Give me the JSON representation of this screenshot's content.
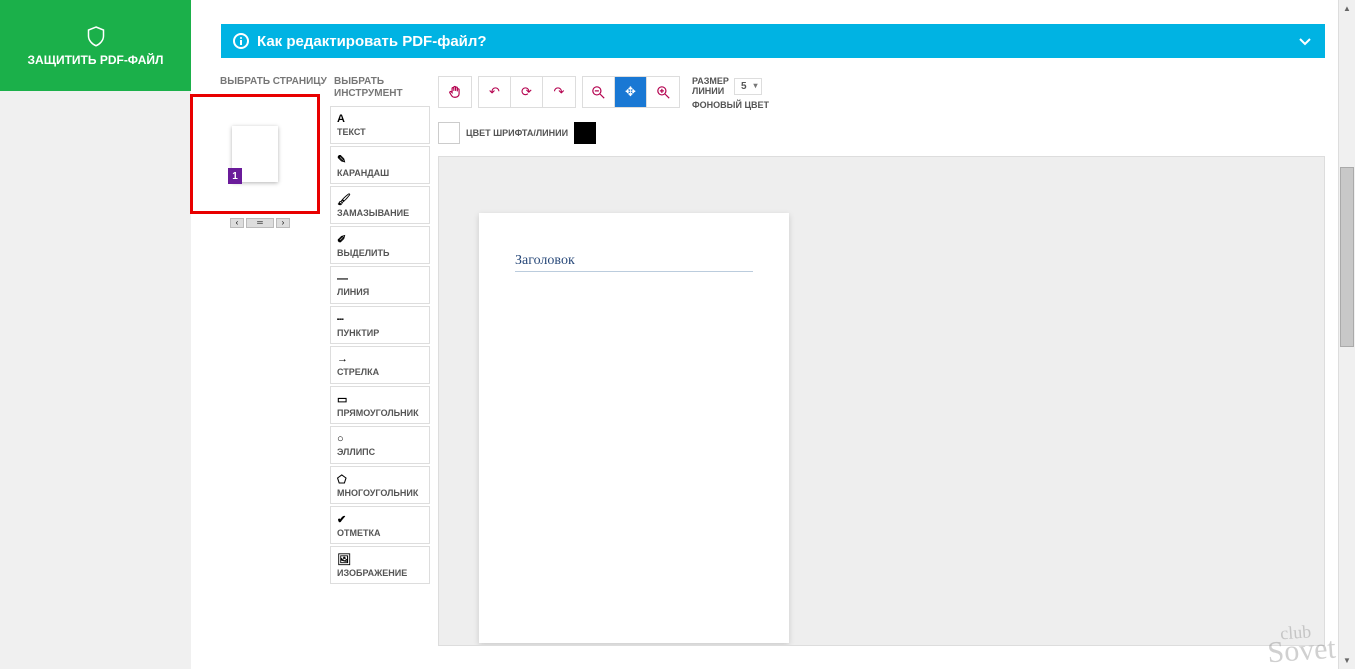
{
  "protect": {
    "label": "ЗАЩИТИТЬ PDF-ФАЙЛ"
  },
  "help_bar": {
    "text": "Как редактировать PDF-файл?"
  },
  "page_selector": {
    "header": "ВЫБРАТЬ СТРАНИЦУ",
    "current": "1"
  },
  "tool_selector": {
    "header": "ВЫБРАТЬ ИНСТРУМЕНТ",
    "tools": [
      {
        "label": "ТЕКСТ"
      },
      {
        "label": "КАРАНДАШ"
      },
      {
        "label": "ЗАМАЗЫВАНИЕ"
      },
      {
        "label": "ВЫДЕЛИТЬ"
      },
      {
        "label": "ЛИНИЯ"
      },
      {
        "label": "ПУНКТИР"
      },
      {
        "label": "СТРЕЛКА"
      },
      {
        "label": "ПРЯМОУГОЛЬНИК"
      },
      {
        "label": "ЭЛЛИПС"
      },
      {
        "label": "МНОГОУГОЛЬНИК"
      },
      {
        "label": "ОТМЕТКА"
      },
      {
        "label": "ИЗОБРАЖЕНИЕ"
      }
    ]
  },
  "toolbar": {
    "size_label": "РАЗМЕР ЛИНИИ",
    "size_value": "5",
    "bg_label": "ФОНОВЫЙ ЦВЕТ",
    "font_color_label": "ЦВЕТ ШРИФТА/ЛИНИИ"
  },
  "document": {
    "heading": "Заголовок"
  },
  "watermark": {
    "line1": "club",
    "line2": "Sovet"
  }
}
